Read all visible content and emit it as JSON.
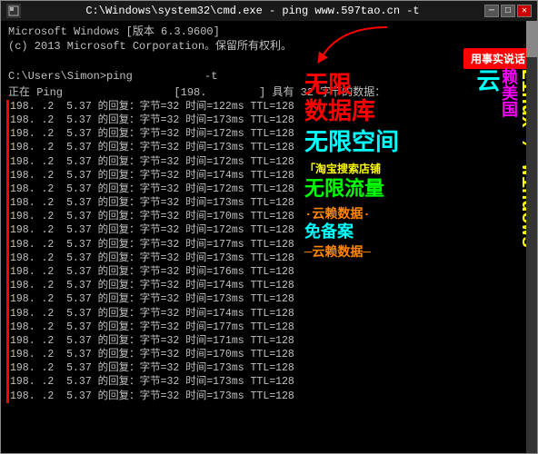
{
  "window": {
    "title": "C:\\Windows\\system32\\cmd.exe - ping  www.597tao.cn -t",
    "title_label": "C:\\Windows\\system32\\cmd.exe - ping  www.597tao.cn -t"
  },
  "header": {
    "line1": "Microsoft Windows [版本 6.3.9600]",
    "line2": "(c) 2013 Microsoft Corporation。保留所有权利。",
    "line3": "",
    "line4": "C:\\Users\\Simon>ping           -t"
  },
  "ping_status": "正在 Ping                 [198.        ] 具有 32 字节的数据：",
  "bubble": "用事实说话",
  "overlay": {
    "unlimited_db": "无限数据库",
    "dash1": "－",
    "unlimited_space": "无限空间",
    "taobao": "「淘宝搜索店铺",
    "unlimited_flow": "无限流量",
    "dash2": "·",
    "free_backup": "·云赖数据·",
    "dash3": "－",
    "cloud": "云",
    "rely_usa": "赖美国",
    "linux_windows": "Linux / Windows"
  },
  "rows": [
    "198. .2  5.37 的回复：字节=32 时间=122ms TTL=128",
    "198. .2  5.37 的回复：字节=32 时间=173ms TTL=128",
    "198. .2  5.37 的回复：字节=32 时间=172ms TTL=128",
    "198. .2  5.37 的回复：字节=32 时间=173ms TTL=128",
    "198. .2  5.37 的回复：字节=32 时间=172ms TTL=128",
    "198. .2  5.37 的回复：字节=32 时间=174ms TTL=128",
    "198. .2  5.37 的回复：字节=32 时间=172ms TTL=128",
    "198. .2  5.37 的回复：字节=32 时间=173ms TTL=128",
    "198. .2  5.37 的回复：字节=32 时间=170ms TTL=128",
    "198. .2  5.37 的回复：字节=32 时间=172ms TTL=128",
    "198. .2  5.37 的回复：字节=32 时间=177ms TTL=128",
    "198. .2  5.37 的回复：字节=32 时间=173ms TTL=128",
    "198. .2  5.37 的回复：字节=32 时间=176ms TTL=128",
    "198. .2  5.37 的回复：字节=32 时间=174ms TTL=128",
    "198. .2  5.37 的回复：字节=32 时间=173ms TTL=128",
    "198. .2  5.37 的回复：字节=32 时间=174ms TTL=128",
    "198. .2  5.37 的回复：字节=32 时间=177ms TTL=128",
    "198. .2  5.37 的回复：字节=32 时间=171ms TTL=128",
    "198. .2  5.37 的回复：字节=32 时间=170ms TTL=128",
    "198. .2  5.37 的回复：字节=32 时间=173ms TTL=128",
    "198. .2  5.37 的回复：字节=32 时间=173ms TTL=128",
    "198. .2  5.37 的回复：字节=32 时间=173ms TTL=128"
  ],
  "buttons": {
    "minimize": "─",
    "maximize": "□",
    "close": "✕"
  }
}
